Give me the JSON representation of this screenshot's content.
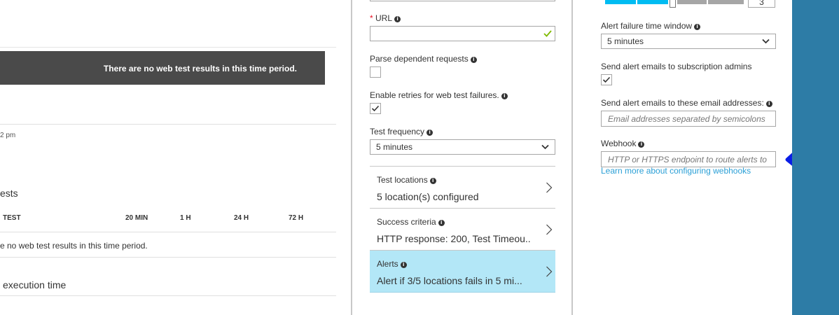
{
  "left_panel": {
    "banner_text": "There are no web test results in this time period.",
    "time_axis_label": "2 pm",
    "section_title": "ests",
    "table": {
      "headers": [
        "TEST",
        "20 MIN",
        "1 H",
        "24 H",
        "72 H"
      ],
      "empty_text": "e no web test results in this time period."
    },
    "execution_title": "execution time"
  },
  "middle_panel": {
    "url": {
      "label": "URL",
      "required_mark": "*",
      "value": ""
    },
    "parse_dependent": {
      "label": "Parse dependent requests",
      "checked": false
    },
    "enable_retries": {
      "label": "Enable retries for web test failures.",
      "checked": true
    },
    "test_frequency": {
      "label": "Test frequency",
      "value": "5 minutes"
    },
    "test_locations": {
      "title": "Test locations",
      "value": "5 location(s) configured"
    },
    "success_criteria": {
      "title": "Success criteria",
      "value": "HTTP response: 200, Test Timeou..."
    },
    "alerts": {
      "title": "Alerts",
      "value": "Alert if 3/5 locations fails in 5 mi..."
    }
  },
  "right_panel": {
    "locations_threshold": {
      "value": "3"
    },
    "alert_failure_window": {
      "label": "Alert failure time window",
      "value": "5 minutes"
    },
    "send_to_admins": {
      "label": "Send alert emails to subscription admins",
      "checked": true
    },
    "email_addresses": {
      "label": "Send alert emails to these email addresses:",
      "placeholder": "Email addresses separated by semicolons"
    },
    "webhook": {
      "label": "Webhook",
      "placeholder": "HTTP or HTTPS endpoint to route alerts to",
      "learn_more": "Learn more about configuring webhooks"
    }
  },
  "colors": {
    "accent": "#00bcf2",
    "selected_row": "#b3e7f7",
    "sidebar": "#2d7ca6",
    "banner": "#4a4a4a",
    "link": "#2a9fd6",
    "valid": "#7fba00",
    "annotation": "#0000ee"
  }
}
